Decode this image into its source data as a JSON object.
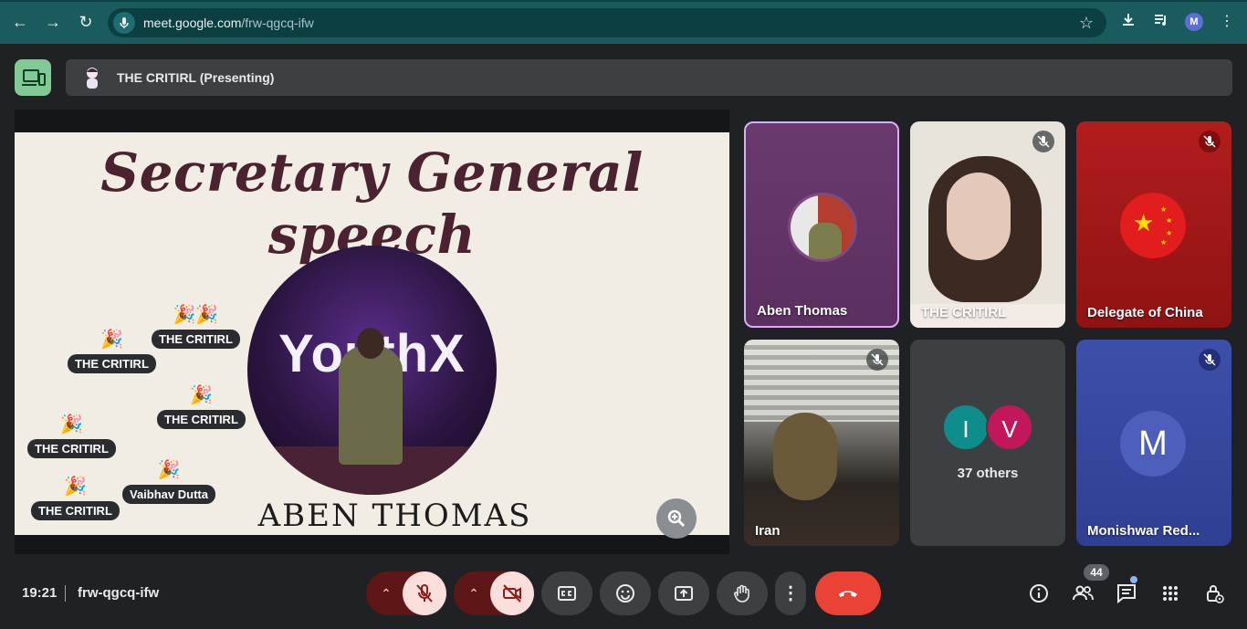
{
  "browser": {
    "url_host": "meet.google.com",
    "url_path": "/frw-qgcq-ifw",
    "profile_initial": "M"
  },
  "presenting": {
    "title": "THE CRITIRL (Presenting)"
  },
  "slide": {
    "title": "Secretary General speech",
    "speaker_name": "ABEN THOMAS",
    "brand_text": "YouthX"
  },
  "reactions": [
    {
      "name": "THE CRITIRL",
      "emoji": "🎉"
    },
    {
      "name": "THE CRITIRL",
      "emoji": "🎉🎉"
    },
    {
      "name": "THE CRITIRL",
      "emoji": "🎉"
    },
    {
      "name": "THE CRITIRL",
      "emoji": "🎉"
    },
    {
      "name": "Vaibhav Dutta",
      "emoji": "🎉"
    },
    {
      "name": "THE CRITIRL",
      "emoji": "🎉"
    }
  ],
  "participants": [
    {
      "name": "Aben Thomas",
      "muted": false,
      "active_speaker": true
    },
    {
      "name": "THE CRITIRL",
      "muted": true
    },
    {
      "name": "Delegate of China",
      "muted": true
    },
    {
      "name": "Iran",
      "muted": true
    },
    {
      "name": "37 others",
      "avatars": [
        "I",
        "V"
      ]
    },
    {
      "name": "Monishwar Red...",
      "muted": true,
      "avatar": "M"
    }
  ],
  "footer": {
    "time": "19:21",
    "meeting_code": "frw-qgcq-ifw",
    "people_count": "44"
  },
  "colors": {
    "browser_bar": "#1a5b5e",
    "leave_button": "#ea4335",
    "active_speaker_border": "#d7aefb",
    "present_toggle": "#81c995"
  }
}
